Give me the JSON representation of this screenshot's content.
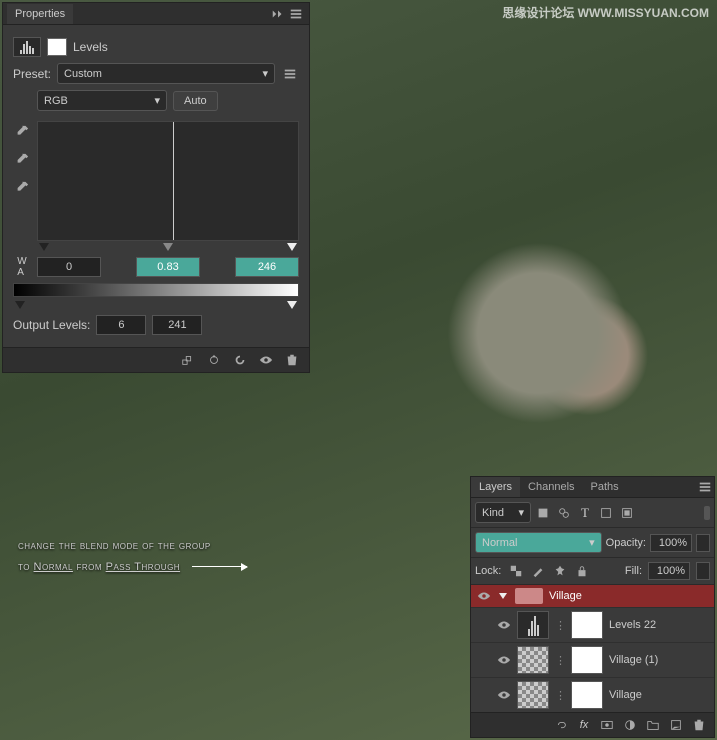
{
  "watermark": "思缘设计论坛  WWW.MISSYUAN.COM",
  "props": {
    "panel_title": "Properties",
    "adjustment_title": "Levels",
    "preset_label": "Preset:",
    "preset_value": "Custom",
    "channel": "RGB",
    "auto_label": "Auto",
    "input_shadow": "0",
    "input_mid": "0.83",
    "input_highlight": "246",
    "output_label": "Output Levels:",
    "output_shadow": "6",
    "output_highlight": "241"
  },
  "layers_panel": {
    "tabs": [
      "Layers",
      "Channels",
      "Paths"
    ],
    "kind_label": "Kind",
    "kind_value": "≡",
    "blend_mode": "Normal",
    "opacity_label": "Opacity:",
    "opacity_value": "100%",
    "lock_label": "Lock:",
    "fill_label": "Fill:",
    "fill_value": "100%",
    "group_name": "Village",
    "layers": [
      {
        "name": "Levels 22"
      },
      {
        "name": "Village (1)"
      },
      {
        "name": "Village"
      }
    ]
  },
  "annotation": {
    "line1": "change the blend mode of the group",
    "line2_a": "to ",
    "line2_b": "Normal",
    "line2_c": " from ",
    "line2_d": "Pass Through"
  }
}
